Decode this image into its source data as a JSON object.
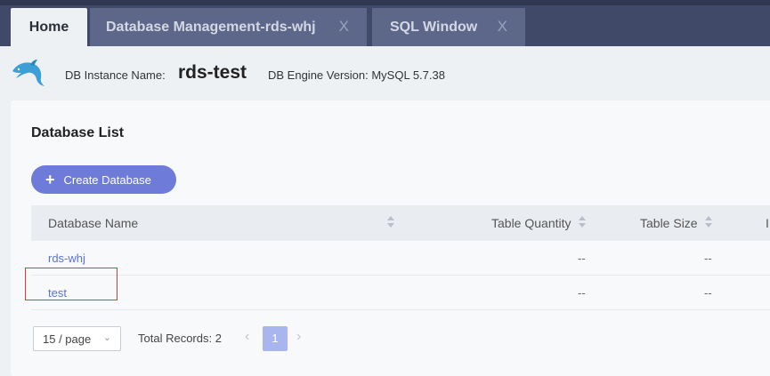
{
  "tabs": [
    {
      "label": "Home"
    },
    {
      "label": "Database Management-rds-whj",
      "close": "X"
    },
    {
      "label": "SQL Window",
      "close": "X"
    }
  ],
  "instance": {
    "name_label": "DB Instance Name:",
    "name_value": "rds-test",
    "engine_label": "DB Engine Version: MySQL 5.7.38"
  },
  "db_list": {
    "title": "Database List",
    "create_button": {
      "icon": "+",
      "label": "Create Database"
    },
    "columns": [
      "Database Name",
      "Table Quantity",
      "Table Size",
      "I"
    ],
    "rows": [
      {
        "name": "rds-whj",
        "table_quantity": "--",
        "table_size": "--"
      },
      {
        "name": "test",
        "table_quantity": "--",
        "table_size": "--"
      }
    ]
  },
  "pagination": {
    "page_size": "15 / page",
    "total": "Total Records: 2",
    "current_page": "1"
  },
  "colors": {
    "accent": "#6e7bd9",
    "link": "#5b73d6",
    "tabbar": "#404a68",
    "highlight": "#d93b3b"
  }
}
